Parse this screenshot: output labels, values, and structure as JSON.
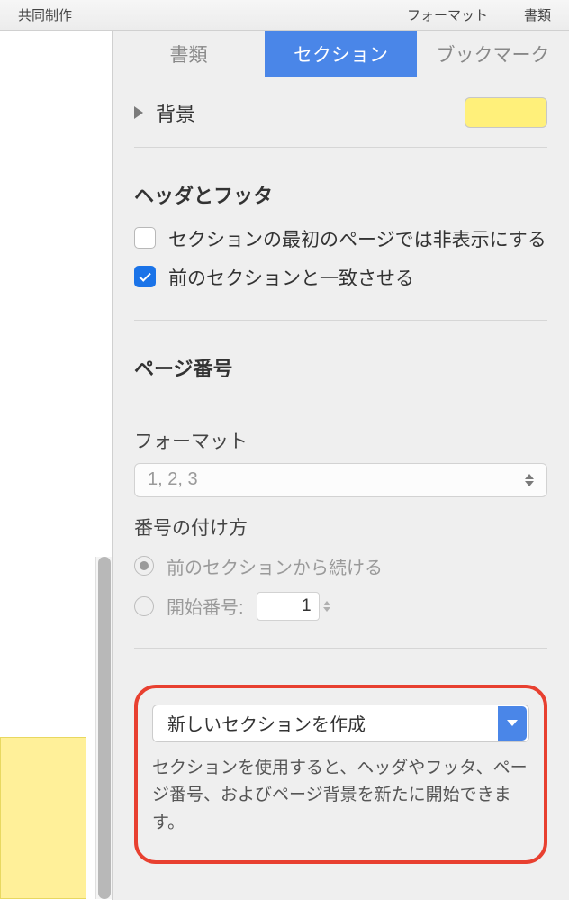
{
  "toolbar": {
    "collaborate": "共同制作",
    "format": "フォーマット",
    "document": "書類"
  },
  "tabs": {
    "document": "書類",
    "section": "セクション",
    "bookmarks": "ブックマーク"
  },
  "background": {
    "label": "背景",
    "color": "#fff07a"
  },
  "headers_footers": {
    "title": "ヘッダとフッタ",
    "hide_first": "セクションの最初のページでは非表示にする",
    "match_previous": "前のセクションと一致させる"
  },
  "page_numbers": {
    "title": "ページ番号",
    "format_label": "フォーマット",
    "format_value": "1, 2, 3",
    "numbering_label": "番号の付け方",
    "continue_label": "前のセクションから続ける",
    "start_at_label": "開始番号:",
    "start_at_value": "1"
  },
  "create_section": {
    "label": "新しいセクションを作成",
    "help": "セクションを使用すると、ヘッダやフッタ、ページ番号、およびページ背景を新たに開始できます。"
  }
}
